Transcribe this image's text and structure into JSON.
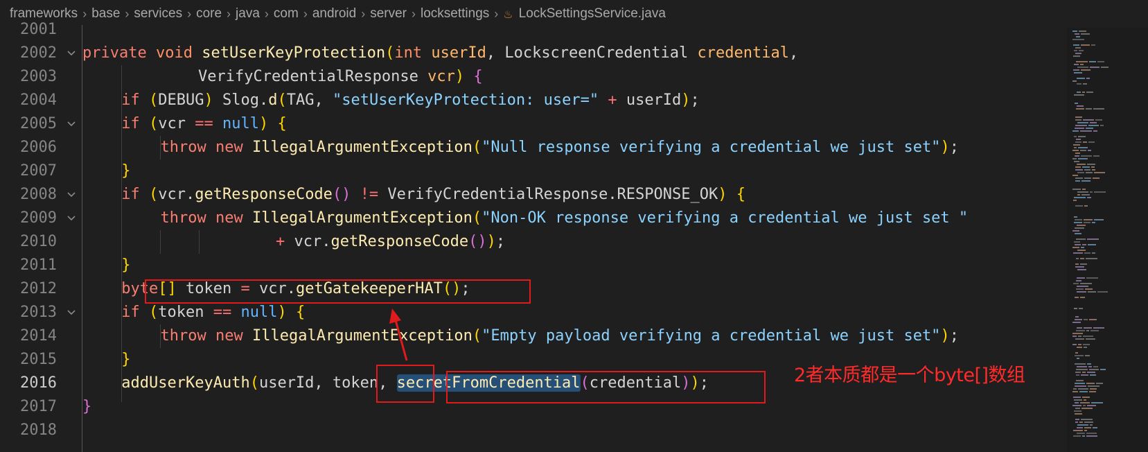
{
  "breadcrumb": {
    "segments": [
      "frameworks",
      "base",
      "services",
      "core",
      "java",
      "com",
      "android",
      "server",
      "locksettings"
    ],
    "file_icon": "java-file-icon",
    "file": "LockSettingsService.java"
  },
  "editor": {
    "active_line": "2016",
    "lines": [
      {
        "n": "2001",
        "fold": false,
        "indent": 0,
        "tokens": []
      },
      {
        "n": "2002",
        "fold": true,
        "indent": 1,
        "tokens": [
          [
            "kw",
            "private"
          ],
          [
            "id",
            " "
          ],
          [
            "ty",
            "void"
          ],
          [
            "id",
            " "
          ],
          [
            "fn",
            "setUserKeyProtection"
          ],
          [
            "brk",
            "("
          ],
          [
            "ty",
            "int"
          ],
          [
            "id",
            " "
          ],
          [
            "par",
            "userId"
          ],
          [
            "id",
            ", LockscreenCredential "
          ],
          [
            "par",
            "credential"
          ],
          [
            "id",
            ","
          ]
        ]
      },
      {
        "n": "2003",
        "fold": false,
        "indent": 3,
        "tokens": [
          [
            "id",
            "VerifyCredentialResponse "
          ],
          [
            "par",
            "vcr"
          ],
          [
            "brk",
            ")"
          ],
          [
            "id",
            " "
          ],
          [
            "brk2",
            "{"
          ]
        ]
      },
      {
        "n": "2004",
        "fold": false,
        "indent": 2,
        "tokens": [
          [
            "kw",
            "if"
          ],
          [
            "id",
            " "
          ],
          [
            "brk",
            "("
          ],
          [
            "id",
            "DEBUG"
          ],
          [
            "brk",
            ")"
          ],
          [
            "id",
            " Slog."
          ],
          [
            "fn",
            "d"
          ],
          [
            "brk",
            "("
          ],
          [
            "id",
            "TAG, "
          ],
          [
            "str",
            "\"setUserKeyProtection: user=\""
          ],
          [
            "id",
            " "
          ],
          [
            "op",
            "+"
          ],
          [
            "id",
            " userId"
          ],
          [
            "brk",
            ")"
          ],
          [
            "id",
            ";"
          ]
        ]
      },
      {
        "n": "2005",
        "fold": true,
        "indent": 2,
        "tokens": [
          [
            "kw",
            "if"
          ],
          [
            "id",
            " "
          ],
          [
            "brk",
            "("
          ],
          [
            "id",
            "vcr "
          ],
          [
            "op",
            "=="
          ],
          [
            "id",
            " "
          ],
          [
            "nl",
            "null"
          ],
          [
            "brk",
            ")"
          ],
          [
            "id",
            " "
          ],
          [
            "brk",
            "{"
          ]
        ]
      },
      {
        "n": "2006",
        "fold": false,
        "indent": 3,
        "tokens": [
          [
            "kw",
            "throw"
          ],
          [
            "id",
            " "
          ],
          [
            "kw",
            "new"
          ],
          [
            "id",
            " "
          ],
          [
            "fn",
            "IllegalArgumentException"
          ],
          [
            "brk",
            "("
          ],
          [
            "str",
            "\"Null response verifying a credential we just set\""
          ],
          [
            "brk",
            ")"
          ],
          [
            "id",
            ";"
          ]
        ]
      },
      {
        "n": "2007",
        "fold": false,
        "indent": 2,
        "tokens": [
          [
            "brk",
            "}"
          ]
        ]
      },
      {
        "n": "2008",
        "fold": true,
        "indent": 2,
        "tokens": [
          [
            "kw",
            "if"
          ],
          [
            "id",
            " "
          ],
          [
            "brk",
            "("
          ],
          [
            "id",
            "vcr."
          ],
          [
            "fn",
            "getResponseCode"
          ],
          [
            "brk2",
            "()"
          ],
          [
            "id",
            " "
          ],
          [
            "op",
            "!="
          ],
          [
            "id",
            " VerifyCredentialResponse.RESPONSE_OK"
          ],
          [
            "brk",
            ")"
          ],
          [
            "id",
            " "
          ],
          [
            "brk",
            "{"
          ]
        ]
      },
      {
        "n": "2009",
        "fold": true,
        "indent": 3,
        "tokens": [
          [
            "kw",
            "throw"
          ],
          [
            "id",
            " "
          ],
          [
            "kw",
            "new"
          ],
          [
            "id",
            " "
          ],
          [
            "fn",
            "IllegalArgumentException"
          ],
          [
            "brk",
            "("
          ],
          [
            "str",
            "\"Non-OK response verifying a credential we just set \""
          ]
        ]
      },
      {
        "n": "2010",
        "fold": false,
        "indent": 5,
        "cont": true,
        "tokens": [
          [
            "op",
            "+"
          ],
          [
            "id",
            " vcr."
          ],
          [
            "fn",
            "getResponseCode"
          ],
          [
            "brk2",
            "()"
          ],
          [
            "brk",
            ")"
          ],
          [
            "id",
            ";"
          ]
        ]
      },
      {
        "n": "2011",
        "fold": false,
        "indent": 2,
        "tokens": [
          [
            "brk",
            "}"
          ]
        ]
      },
      {
        "n": "2012",
        "fold": false,
        "indent": 2,
        "tokens": [
          [
            "kw",
            "byte"
          ],
          [
            "brk",
            "[]"
          ],
          [
            "id",
            " token "
          ],
          [
            "op",
            "="
          ],
          [
            "id",
            " vcr."
          ],
          [
            "fn",
            "getGatekeeperHAT"
          ],
          [
            "brk",
            "()"
          ],
          [
            "id",
            ";"
          ]
        ]
      },
      {
        "n": "2013",
        "fold": true,
        "indent": 2,
        "tokens": [
          [
            "kw",
            "if"
          ],
          [
            "id",
            " "
          ],
          [
            "brk",
            "("
          ],
          [
            "id",
            "token "
          ],
          [
            "op",
            "=="
          ],
          [
            "id",
            " "
          ],
          [
            "nl",
            "null"
          ],
          [
            "brk",
            ")"
          ],
          [
            "id",
            " "
          ],
          [
            "brk",
            "{"
          ]
        ]
      },
      {
        "n": "2014",
        "fold": false,
        "indent": 3,
        "tokens": [
          [
            "kw",
            "throw"
          ],
          [
            "id",
            " "
          ],
          [
            "kw",
            "new"
          ],
          [
            "id",
            " "
          ],
          [
            "fn",
            "IllegalArgumentException"
          ],
          [
            "brk",
            "("
          ],
          [
            "str",
            "\"Empty payload verifying a credential we just set\""
          ],
          [
            "brk",
            ")"
          ],
          [
            "id",
            ";"
          ]
        ]
      },
      {
        "n": "2015",
        "fold": false,
        "indent": 2,
        "tokens": [
          [
            "brk",
            "}"
          ]
        ]
      },
      {
        "n": "2016",
        "fold": false,
        "indent": 2,
        "tokens": [
          [
            "fn",
            "addUserKeyAuth"
          ],
          [
            "brk",
            "("
          ],
          [
            "id",
            "userId, token, "
          ],
          [
            "fnhl",
            "secretFromCredential"
          ],
          [
            "brk2",
            "("
          ],
          [
            "id",
            "credential"
          ],
          [
            "brk2",
            ")"
          ],
          [
            "brk",
            ")"
          ],
          [
            "id",
            ";"
          ]
        ]
      },
      {
        "n": "2017",
        "fold": false,
        "indent": 1,
        "tokens": [
          [
            "brk2",
            "}"
          ]
        ]
      },
      {
        "n": "2018",
        "fold": false,
        "indent": 0,
        "tokens": []
      }
    ]
  },
  "annotation": {
    "note": "2者本质都是一个byte[]数组",
    "color": "#e11b1b"
  }
}
